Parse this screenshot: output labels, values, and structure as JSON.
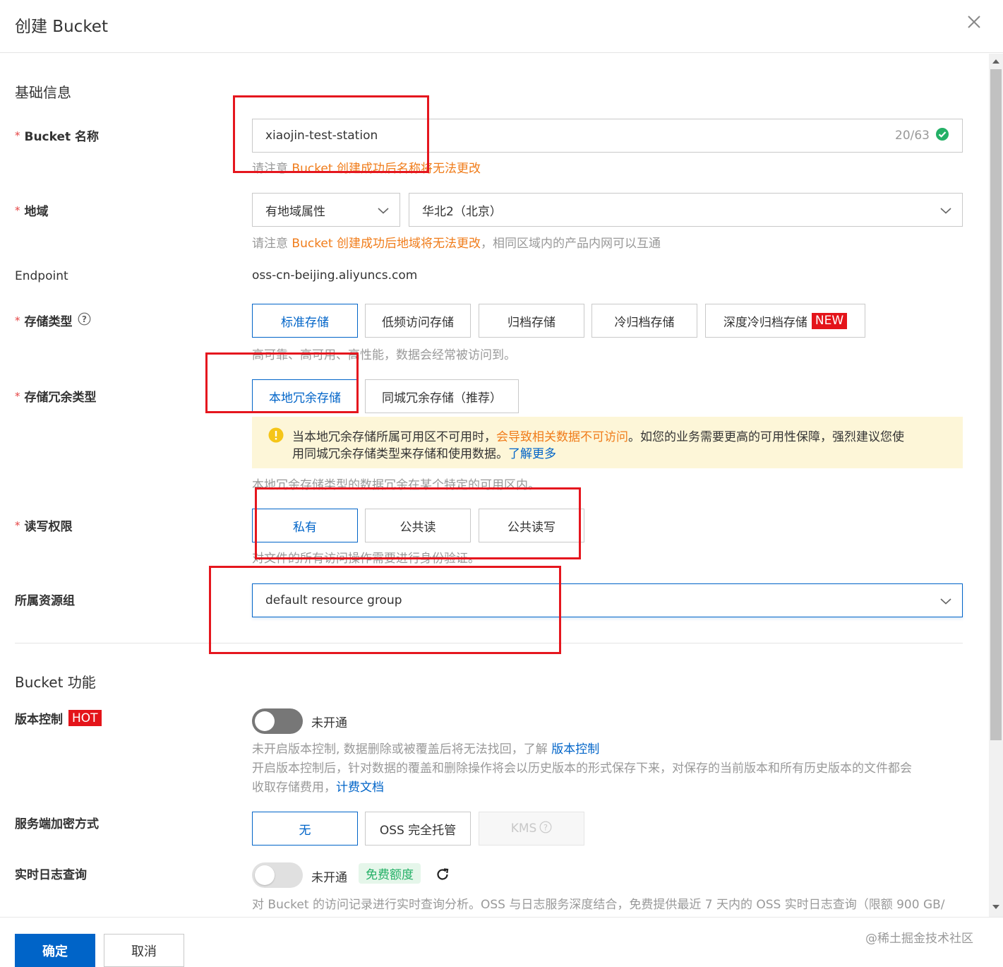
{
  "dialog": {
    "title": "创建 Bucket"
  },
  "basic": {
    "section_title": "基础信息",
    "bucket_name": {
      "label": "Bucket 名称",
      "value": "xiaojin-test-station",
      "counter": "20/63",
      "hint_prefix": "请注意",
      "hint_warn": "Bucket 创建成功后名称将无法更改"
    },
    "region": {
      "label": "地域",
      "type_value": "有地域属性",
      "region_value": "华北2（北京）",
      "hint_prefix": "请注意",
      "hint_warn": "Bucket 创建成功后地域将无法更改",
      "hint_suffix": "，相同区域内的产品内网可以互通"
    },
    "endpoint": {
      "label": "Endpoint",
      "value": "oss-cn-beijing.aliyuncs.com"
    },
    "storage_class": {
      "label": "存储类型",
      "options": [
        "标准存储",
        "低频访问存储",
        "归档存储",
        "冷归档存储",
        "深度冷归档存储"
      ],
      "new_badge": "NEW",
      "selected": "标准存储",
      "hint": "高可靠、高可用、高性能，数据会经常被访问到。"
    },
    "redundancy": {
      "label": "存储冗余类型",
      "options": [
        "本地冗余存储",
        "同城冗余存储（推荐）"
      ],
      "selected": "本地冗余存储",
      "alert_text_1": "当本地冗余存储所属可用区不可用时，",
      "alert_warn": "会导致相关数据不可访问",
      "alert_text_2": "。如您的业务需要更高的可用性保障，强烈建议您使",
      "alert_text_3": "用同城冗余存储类型来存储和使用数据。",
      "alert_link": "了解更多",
      "hint": "本地冗余存储类型的数据冗余在某个特定的可用区内。"
    },
    "acl": {
      "label": "读写权限",
      "options": [
        "私有",
        "公共读",
        "公共读写"
      ],
      "selected": "私有",
      "hint": "对文件的所有访问操作需要进行身份验证。"
    },
    "resource_group": {
      "label": "所属资源组",
      "value": "default resource group"
    }
  },
  "features": {
    "section_title": "Bucket 功能",
    "versioning": {
      "label": "版本控制",
      "hot_badge": "HOT",
      "status": "未开通",
      "desc_1": "未开启版本控制, 数据删除或被覆盖后将无法找回，了解",
      "desc_1_link": "版本控制",
      "desc_2": "开启版本控制后，针对数据的覆盖和删除操作将会以历史版本的形式保存下来，对保存的当前版本和所有历史版本的文件都会",
      "desc_3": "收取存储费用，",
      "desc_3_link": "计费文档"
    },
    "encryption": {
      "label": "服务端加密方式",
      "options": [
        "无",
        "OSS 完全托管",
        "KMS"
      ],
      "selected": "无"
    },
    "realtime_log": {
      "label": "实时日志查询",
      "status": "未开通",
      "free_tag": "免费额度",
      "desc": "对 Bucket 的访问记录进行实时查询分析。OSS 与日志服务深度结合，免费提供最近 7 天内的 OSS 实时日志查询（限额 900 GB/"
    }
  },
  "footer": {
    "confirm": "确定",
    "cancel": "取消",
    "watermark": "@稀土掘金技术社区"
  },
  "colors": {
    "primary": "#0064c8",
    "warning": "#f07c1a",
    "annotation_red": "#e5161e",
    "success": "#23b066"
  }
}
